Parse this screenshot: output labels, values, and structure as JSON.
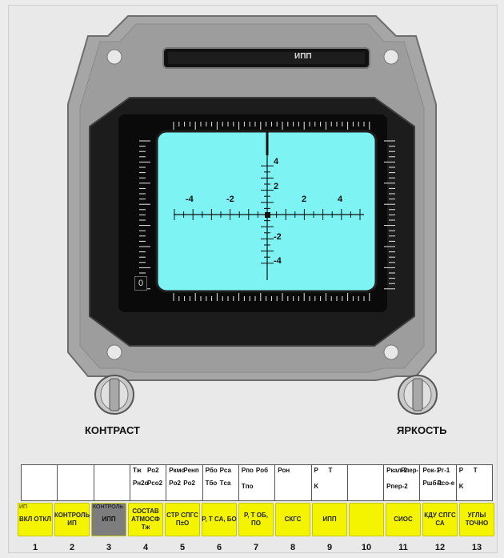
{
  "display": {
    "title": "ИПП",
    "scale_value": "0",
    "x_ticks": [
      "-4",
      "-2",
      "2",
      "4"
    ],
    "y_ticks": [
      "4",
      "2",
      "-2",
      "-4"
    ]
  },
  "knobs": {
    "contrast_label": "КОНТРАСТ",
    "brightness_label": "ЯРКОСТЬ"
  },
  "strip": {
    "cells": [
      {
        "lines": []
      },
      {
        "lines": []
      },
      {
        "lines": []
      },
      {
        "lines": [
          "Tж",
          "Po2",
          "Pн2o",
          "Pco2"
        ]
      },
      {
        "lines": [
          "Pкмо",
          "Pенп",
          "Po2",
          "Po2"
        ]
      },
      {
        "lines": [
          "Pбо",
          "Pса",
          "Tбо",
          "Tса"
        ]
      },
      {
        "lines": [
          "Pпо",
          "Pоб",
          "Tпо"
        ]
      },
      {
        "lines": [
          "Pон"
        ]
      },
      {
        "lines": [
          "P",
          "T",
          "K"
        ]
      },
      {
        "lines": []
      },
      {
        "lines": [
          "Pкал-2",
          "Pпер-1",
          "Pпер-2"
        ]
      },
      {
        "lines": [
          "Pок-1",
          "Pг-1",
          "Pшб-1",
          "Pсо-е"
        ]
      },
      {
        "lines": [
          "P",
          "T",
          "K"
        ]
      }
    ]
  },
  "buttons": [
    {
      "label_top": "ИП",
      "label": "ВКЛ ОТКЛ",
      "num": "1"
    },
    {
      "label": "КОНТРОЛЬ ИП",
      "num": "2"
    },
    {
      "label_top": "КОНТРОЛЬ",
      "label": "ИПП",
      "num": "3",
      "active": true
    },
    {
      "label": "СОСТАВ АТМОСФ Тж",
      "num": "4"
    },
    {
      "label": "СТР СПГС П±О",
      "num": "5"
    },
    {
      "label": "Р, Т СА, БО",
      "num": "6"
    },
    {
      "label": "Р, Т ОБ, ПО",
      "num": "7"
    },
    {
      "label": "СКГС",
      "num": "8"
    },
    {
      "label": "ИПП",
      "num": "9"
    },
    {
      "label": "",
      "num": "10"
    },
    {
      "label": "СИОС",
      "num": "11"
    },
    {
      "label": "КДУ СПГС СА",
      "num": "12"
    },
    {
      "label": "УГЛЫ ТОЧНО",
      "num": "13"
    }
  ]
}
